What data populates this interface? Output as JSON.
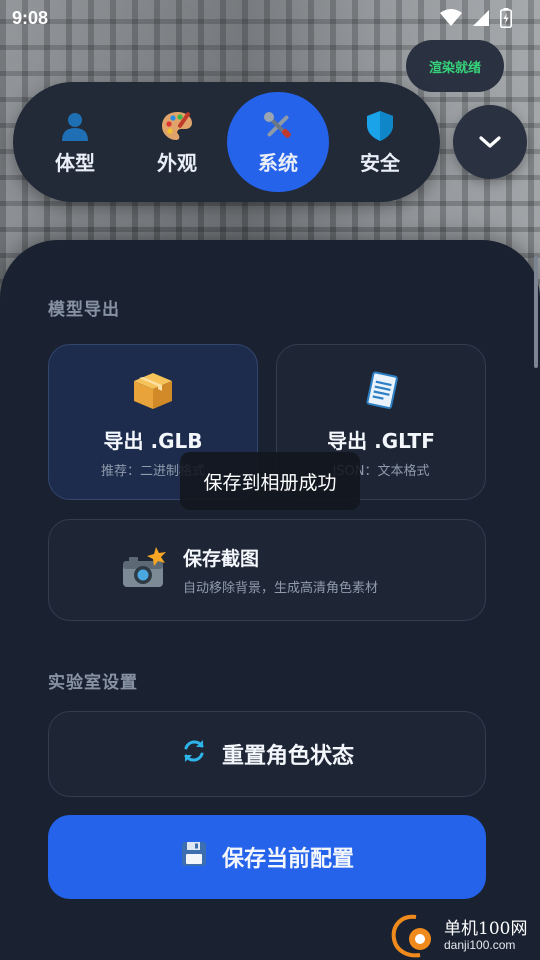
{
  "status_bar": {
    "time": "9:08"
  },
  "render_badge": {
    "label": "渲染就绪",
    "color": "#36d27a"
  },
  "tabs": [
    {
      "label": "体型",
      "icon": "person-icon",
      "active": false
    },
    {
      "label": "外观",
      "icon": "palette-icon",
      "active": false
    },
    {
      "label": "系统",
      "icon": "tools-icon",
      "active": true
    },
    {
      "label": "安全",
      "icon": "shield-icon",
      "active": false
    }
  ],
  "accent_color": "#2563eb",
  "export_section": {
    "title": "模型导出",
    "glb": {
      "title": "导出 .GLB",
      "subtitle": "推荐：二进制格式",
      "icon": "package-icon"
    },
    "gltf": {
      "title": "导出 .GLTF",
      "subtitle": "JSON：文本格式",
      "icon": "document-icon"
    },
    "screenshot": {
      "title": "保存截图",
      "subtitle": "自动移除背景，生成高清角色素材",
      "icon": "camera-flash-icon"
    }
  },
  "lab_section": {
    "title": "实验室设置",
    "reset_label": "重置角色状态",
    "save_label": "保存当前配置"
  },
  "toast": {
    "message": "保存到相册成功"
  },
  "watermark": {
    "main": "单机100网",
    "url": "danji100.com"
  }
}
